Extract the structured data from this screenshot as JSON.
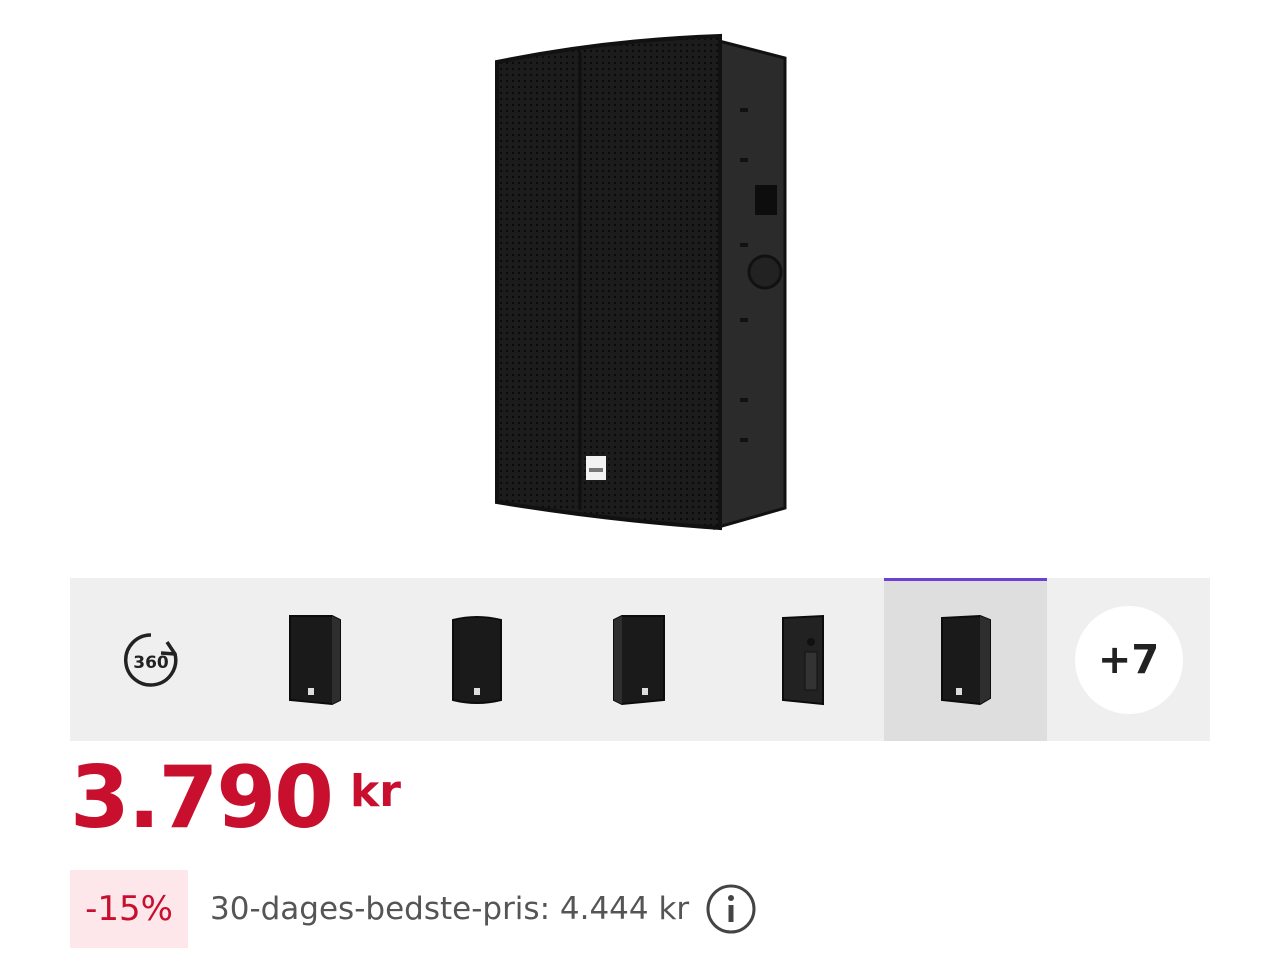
{
  "product": {
    "image_alt": "Speaker cabinet",
    "gallery": {
      "items": [
        {
          "type": "360-view",
          "icon": "360-icon",
          "label": "360"
        },
        {
          "type": "thumbnail",
          "view": "front-left"
        },
        {
          "type": "thumbnail",
          "view": "front"
        },
        {
          "type": "thumbnail",
          "view": "front-right"
        },
        {
          "type": "thumbnail",
          "view": "back"
        },
        {
          "type": "thumbnail",
          "view": "front-angle",
          "active": true
        }
      ],
      "more_label": "+7"
    },
    "price": {
      "value": "3.790",
      "currency": "kr"
    },
    "discount": {
      "badge": "-15%",
      "best_price_text": "30-dages-bedste-pris: 4.444 kr"
    }
  },
  "colors": {
    "price": "#c8102e",
    "badge_bg": "#fde7ea",
    "active_indicator": "#6d3fd3",
    "gallery_bg": "#efefef"
  }
}
